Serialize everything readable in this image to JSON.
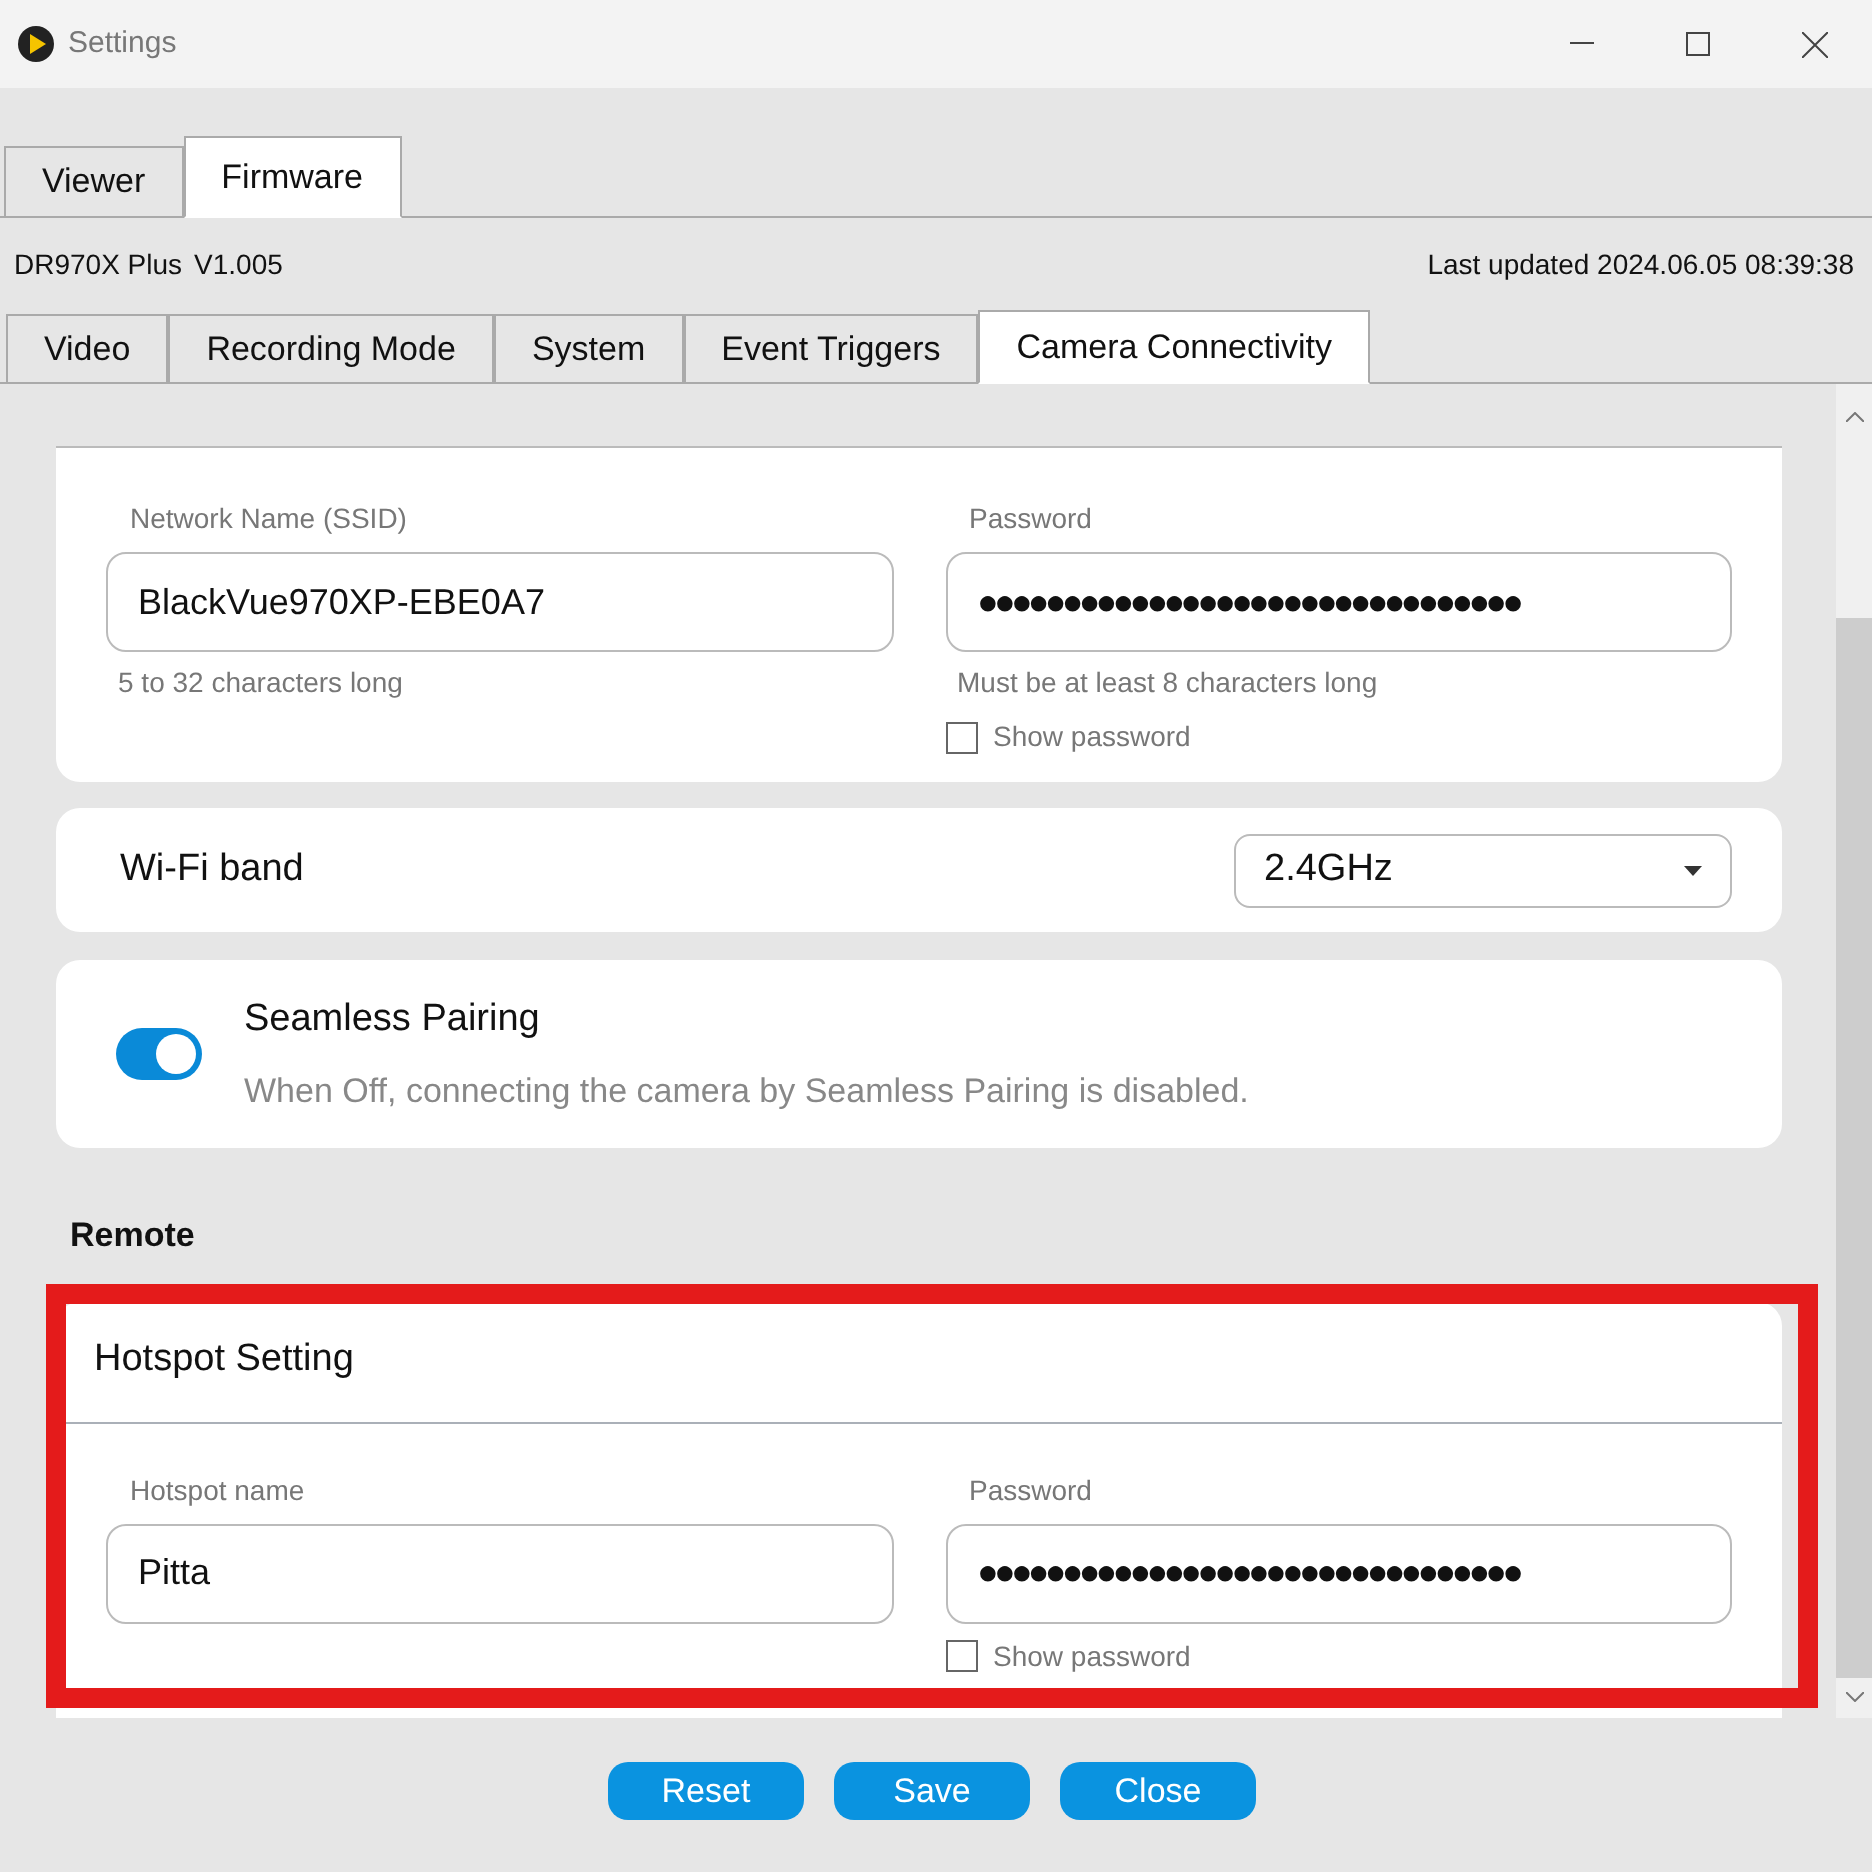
{
  "window": {
    "title": "Settings"
  },
  "main_tabs": [
    {
      "label": "Viewer",
      "selected": false
    },
    {
      "label": "Firmware",
      "selected": true
    }
  ],
  "device": {
    "model": "DR970X Plus",
    "version": "V1.005",
    "last_updated": "Last updated 2024.06.05 08:39:38"
  },
  "sub_tabs": [
    {
      "label": "Video",
      "selected": false
    },
    {
      "label": "Recording Mode",
      "selected": false
    },
    {
      "label": "System",
      "selected": false
    },
    {
      "label": "Event Triggers",
      "selected": false
    },
    {
      "label": "Camera Connectivity",
      "selected": true
    }
  ],
  "wifi_credentials": {
    "fields": [
      {
        "label": "Network Name (SSID)",
        "value": "BlackVue970XP-EBE0A7",
        "hint": "5 to 32 characters long"
      },
      {
        "label": "Password",
        "value": "●●●●●●●●●●●●●●●●●●●●●●●●●●●●●●●●",
        "hint": "Must be at least 8 characters long"
      }
    ],
    "show_password": {
      "label": "Show password",
      "checked": false
    }
  },
  "wifi_band": {
    "label": "Wi-Fi band",
    "value": "2.4GHz"
  },
  "seamless_pairing": {
    "title": "Seamless Pairing",
    "description": "When Off, connecting the camera by Seamless Pairing is disabled.",
    "on": true
  },
  "remote": {
    "heading": "Remote",
    "hotspot": {
      "title": "Hotspot Setting",
      "fields": [
        {
          "label": "Hotspot name",
          "value": "Pitta"
        },
        {
          "label": "Password",
          "value": "●●●●●●●●●●●●●●●●●●●●●●●●●●●●●●●●"
        }
      ],
      "show_password": {
        "label": "Show password",
        "checked": false
      }
    }
  },
  "buttons": [
    "Reset",
    "Save",
    "Close"
  ]
}
